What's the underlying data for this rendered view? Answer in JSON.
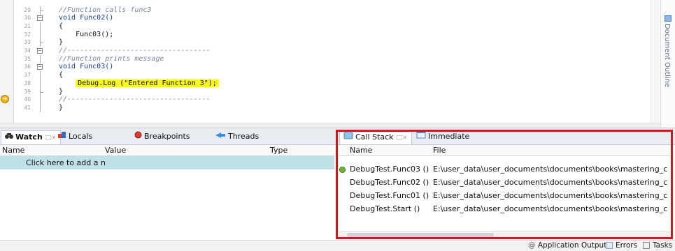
{
  "editor": {
    "lines": [
      {
        "num": "29",
        "text": "//Function calls func3",
        "kind": "comment"
      },
      {
        "num": "30",
        "text": "void Func02()",
        "kind": "code"
      },
      {
        "num": "31",
        "text": "{",
        "kind": "code"
      },
      {
        "num": "32",
        "text": "    Func03();",
        "kind": "code"
      },
      {
        "num": "33",
        "text": "}",
        "kind": "code"
      },
      {
        "num": "34",
        "text": "//----------------------------------",
        "kind": "comment"
      },
      {
        "num": "35",
        "text": "//Function prints message",
        "kind": "comment"
      },
      {
        "num": "36",
        "text": "void Func03()",
        "kind": "code"
      },
      {
        "num": "37",
        "text": "{",
        "kind": "code"
      },
      {
        "num": "38",
        "text": "    Debug.Log (\"Entered Function 3\");",
        "kind": "highlight"
      },
      {
        "num": "39",
        "text": "}",
        "kind": "code"
      },
      {
        "num": "40",
        "text": "//----------------------------------",
        "kind": "comment"
      },
      {
        "num": "41",
        "text": "}",
        "kind": "code"
      }
    ],
    "current_line_marker_icon": "execution-arrow-icon"
  },
  "document_outline": {
    "label": "Document Outline"
  },
  "watch_pad": {
    "tabs": [
      {
        "label": "Watch",
        "icon": "binoculars-icon",
        "close": "□×"
      },
      {
        "label": "Locals",
        "icon": "locals-icon"
      },
      {
        "label": "Breakpoints",
        "icon": "breakpoint-icon"
      },
      {
        "label": "Threads",
        "icon": "threads-icon"
      }
    ],
    "columns": {
      "name": "Name",
      "value": "Value",
      "type": "Type"
    },
    "add_row_text": "Click here to add a n"
  },
  "callstack_pad": {
    "tabs": [
      {
        "label": "Call Stack",
        "icon": "callstack-icon",
        "close": "□×"
      },
      {
        "label": "Immediate",
        "icon": "immediate-icon"
      }
    ],
    "columns": {
      "name": "Name",
      "file": "File"
    },
    "rows": [
      {
        "name": "DebugTest.Func03 ()",
        "file": "E:\\user_data\\user_documents\\documents\\books\\mastering_c"
      },
      {
        "name": "DebugTest.Func02 ()",
        "file": "E:\\user_data\\user_documents\\documents\\books\\mastering_c"
      },
      {
        "name": "DebugTest.Func01 ()",
        "file": "E:\\user_data\\user_documents\\documents\\books\\mastering_c"
      },
      {
        "name": "DebugTest.Start ()",
        "file": "E:\\user_data\\user_documents\\documents\\books\\mastering_c"
      }
    ],
    "highlight_color": "#c0201e"
  },
  "statusbar": {
    "items": [
      {
        "label": "Application Output",
        "icon": "output-icon"
      },
      {
        "label": "Errors",
        "icon": "errors-icon"
      },
      {
        "label": "Tasks",
        "icon": "tasks-icon"
      }
    ]
  }
}
